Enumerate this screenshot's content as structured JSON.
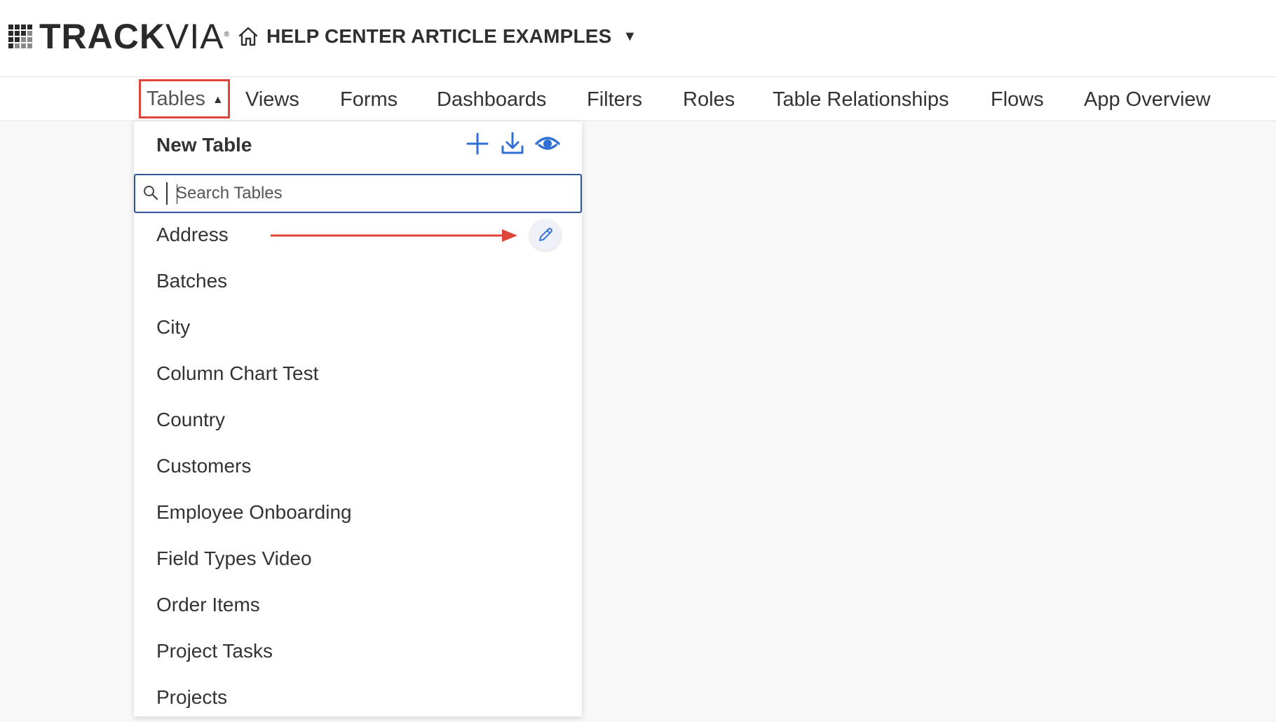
{
  "app": {
    "logo_bold": "TRACK",
    "logo_thin": "VIA",
    "logo_mark": "®",
    "title": "HELP CENTER ARTICLE EXAMPLES",
    "title_caret": "▼"
  },
  "nav": {
    "items": [
      {
        "label": "Tables",
        "active": true
      },
      {
        "label": "Views"
      },
      {
        "label": "Forms"
      },
      {
        "label": "Dashboards"
      },
      {
        "label": "Filters"
      },
      {
        "label": "Roles"
      },
      {
        "label": "Table Relationships"
      },
      {
        "label": "Flows"
      },
      {
        "label": "App Overview"
      }
    ],
    "active_caret": "▲"
  },
  "dropdown": {
    "new_table_label": "New Table",
    "icons": [
      "plus-icon",
      "download-icon",
      "visibility-icon"
    ],
    "search": {
      "placeholder": "Search Tables",
      "value": ""
    },
    "tables": [
      "Address",
      "Batches",
      "City",
      "Column Chart Test",
      "Country",
      "Customers",
      "Employee Onboarding",
      "Field Types Video",
      "Order Items",
      "Project Tasks",
      "Projects"
    ],
    "highlighted_edit_row": "Address"
  },
  "colors": {
    "accent_blue": "#2f6fd6",
    "annotation_red": "#e0453a",
    "search_border": "#2f5597"
  }
}
